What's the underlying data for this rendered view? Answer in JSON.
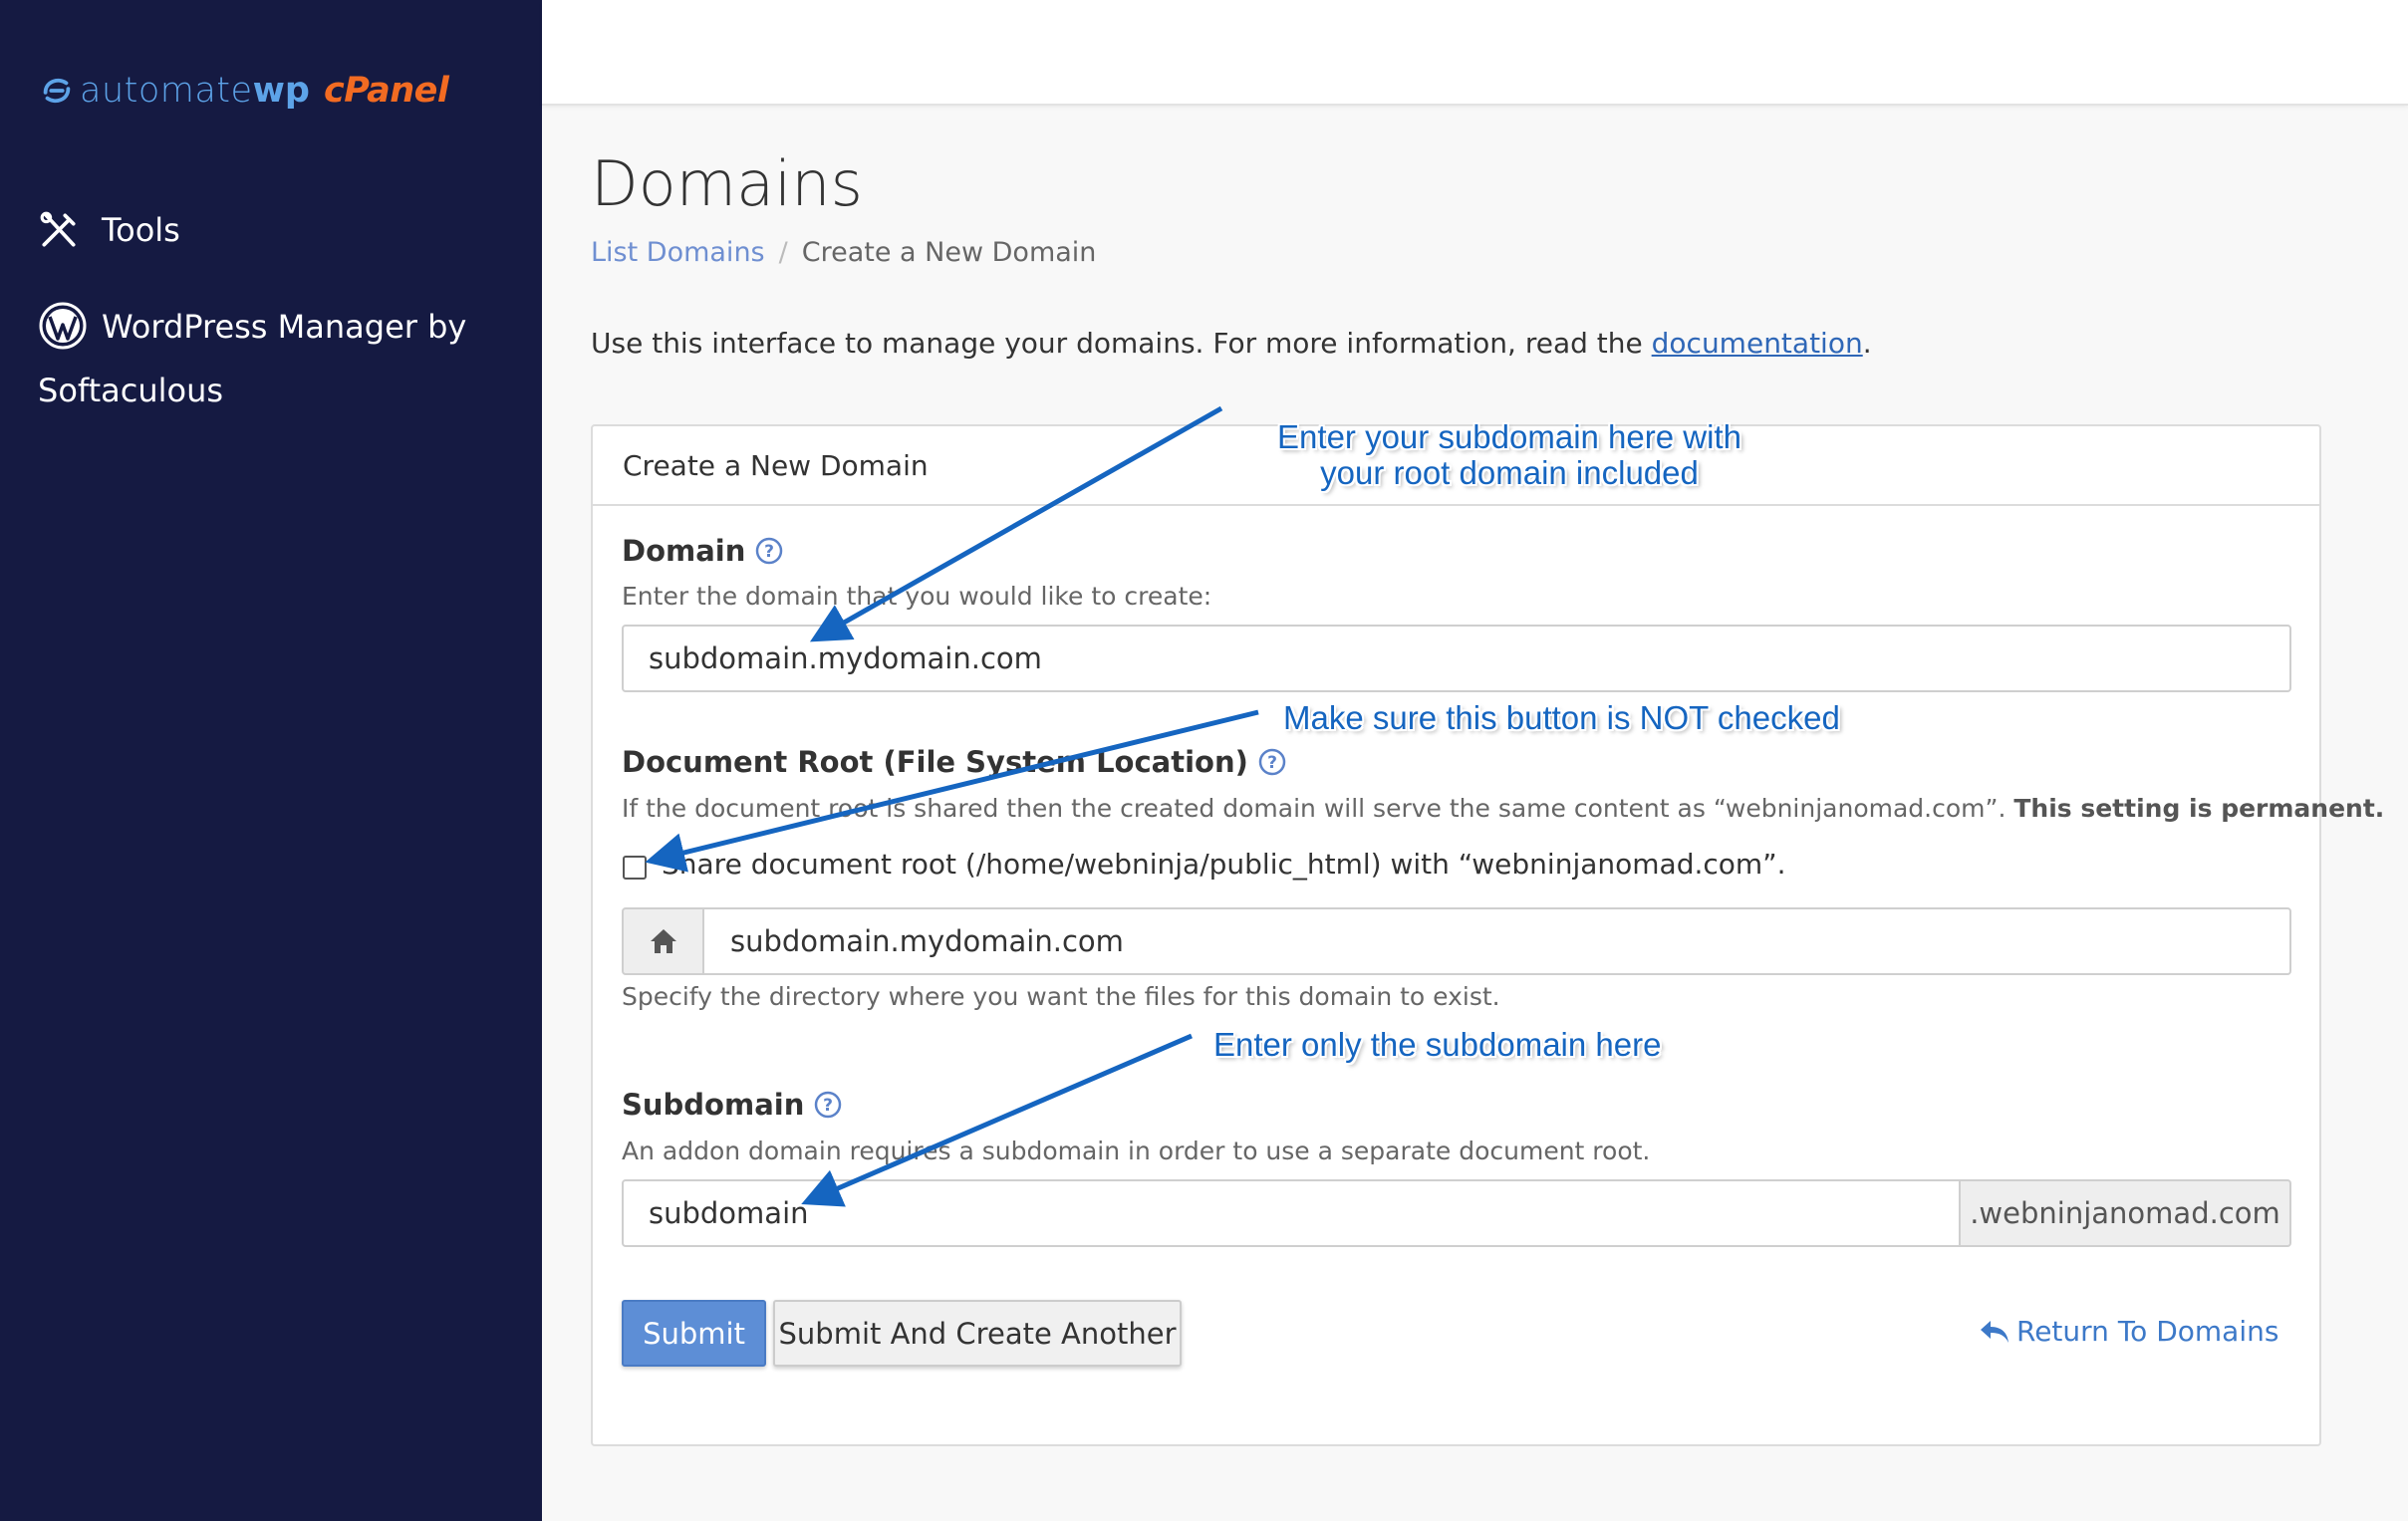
{
  "app": {
    "logo_automate": "automate",
    "logo_wp": "wp",
    "logo_cpanel": "cPanel"
  },
  "sidebar": {
    "items": [
      {
        "label": "Tools",
        "icon": "tools-icon"
      },
      {
        "label": "WordPress Manager by Softaculous",
        "icon": "wordpress-icon"
      }
    ]
  },
  "page": {
    "title": "Domains",
    "breadcrumb": {
      "link": "List Domains",
      "separator": "/",
      "current": "Create a New Domain"
    },
    "intro_text": "Use this interface to manage your domains. For more information, read the ",
    "intro_link": "documentation",
    "intro_end": "."
  },
  "panel": {
    "heading": "Create a New Domain",
    "domain": {
      "label": "Domain",
      "hint": "Enter the domain that you would like to create:",
      "value": "subdomain.mydomain.com"
    },
    "docroot": {
      "label": "Document Root (File System Location)",
      "hint": "If the document root is shared then the created domain will serve the same content as “webninjanomad.com”. ",
      "hint_bold": "This setting is permanent.",
      "checkbox_label": "Share document root (/home/webninja/public_html) with “webninjanomad.com”.",
      "checked": false,
      "value": "subdomain.mydomain.com",
      "help": "Specify the directory where you want the files for this domain to exist."
    },
    "subdomain": {
      "label": "Subdomain",
      "hint": "An addon domain requires a subdomain in order to use a separate document root.",
      "value": "subdomain",
      "suffix": ".webninjanomad.com"
    },
    "buttons": {
      "submit": "Submit",
      "submit_another": "Submit And Create Another",
      "return": "Return To Domains"
    }
  },
  "annotations": {
    "note1_line1": "Enter your subdomain here with",
    "note1_line2": "your root domain included",
    "note2": "Make sure this button is NOT checked",
    "note3": "Enter only the subdomain here",
    "color": "#1565c0"
  },
  "colors": {
    "sidebar_bg": "#151a42",
    "primary": "#5d8ed6",
    "link": "#3d79c8",
    "cpanel_orange": "#f26b22"
  }
}
